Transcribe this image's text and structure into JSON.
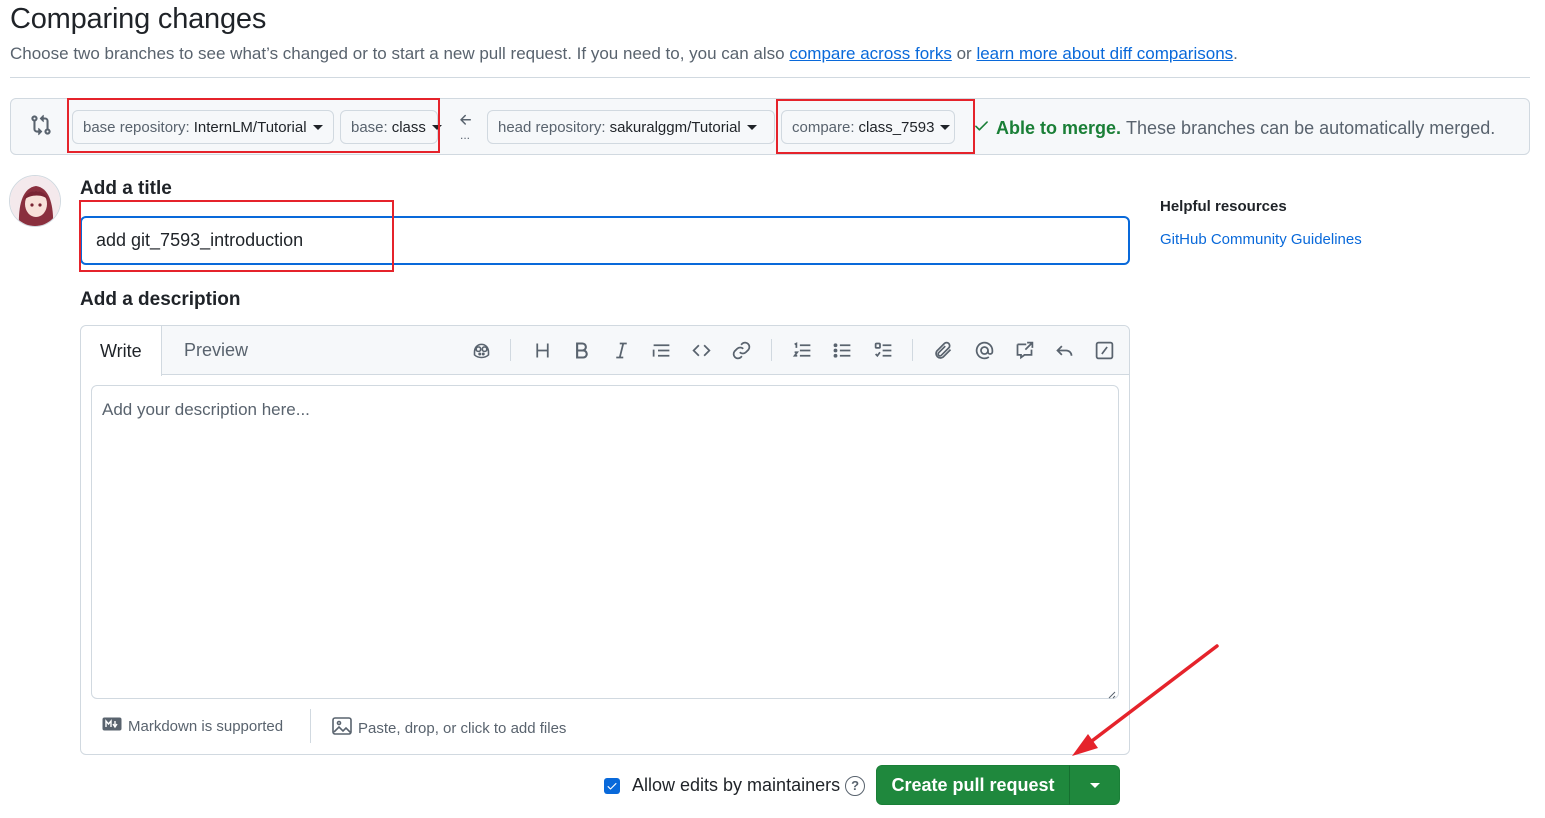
{
  "header": {
    "title": "Comparing changes",
    "subtitle_prefix": "Choose two branches to see what’s changed or to start a new pull request. If you need to, you can also",
    "link_forks": "compare across forks",
    "subtitle_or": "or",
    "link_learn": "learn more about diff comparisons",
    "subtitle_end": "."
  },
  "range": {
    "base_repo_label": "base repository:",
    "base_repo_value": "InternLM/Tutorial",
    "base_label": "base:",
    "base_value": "class",
    "ellipsis": "...",
    "head_repo_label": "head repository:",
    "head_repo_value": "sakuralggm/Tutorial",
    "compare_label": "compare:",
    "compare_value": "class_7593",
    "merge_status": "Able to merge.",
    "merge_detail": "These branches can be automatically merged."
  },
  "form": {
    "title_label": "Add a title",
    "title_value": "add git_7593_introduction",
    "desc_label": "Add a description",
    "tab_write": "Write",
    "tab_preview": "Preview",
    "desc_placeholder": "Add your description here...",
    "markdown_hint": "Markdown is supported",
    "attach_hint": "Paste, drop, or click to add files",
    "allow_edits": "Allow edits by maintainers",
    "create_button": "Create pull request"
  },
  "sidebar": {
    "title": "Helpful resources",
    "link": "GitHub Community Guidelines"
  },
  "colors": {
    "accent_blue": "#0969da",
    "success_green": "#1a7f37",
    "button_green": "#1f883d",
    "annotation_red": "#e5232b"
  }
}
